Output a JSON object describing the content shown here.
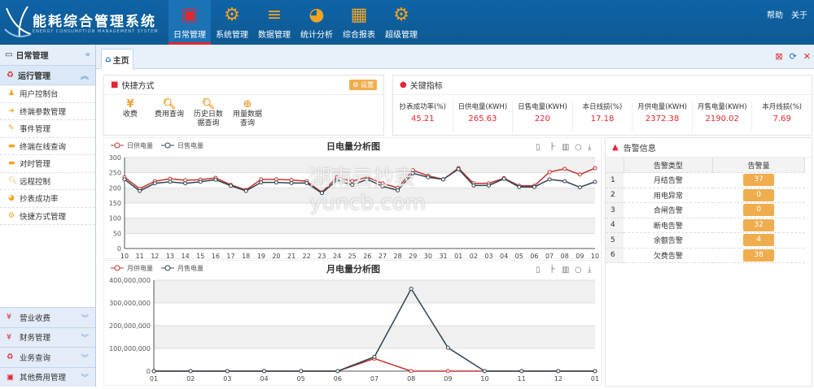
{
  "header": {
    "title": "能耗综合管理系统",
    "subtitle": "ENERGY CONSUMPTION MANAGEMENT SYSTEM",
    "links": [
      "帮助",
      "关于"
    ],
    "nav": [
      {
        "label": "日常管理",
        "icon": "calendar-icon"
      },
      {
        "label": "系统管理",
        "icon": "gears-icon"
      },
      {
        "label": "数据管理",
        "icon": "database-icon"
      },
      {
        "label": "统计分析",
        "icon": "pie-chart-icon"
      },
      {
        "label": "综合报表",
        "icon": "table-icon"
      },
      {
        "label": "超级管理",
        "icon": "gears-icon"
      }
    ]
  },
  "sidebar": {
    "title": "日常管理",
    "group": "运行管理",
    "items": [
      {
        "label": "用户控制台",
        "icon": "user-icon"
      },
      {
        "label": "终端参数管理",
        "icon": "sign-in-icon"
      },
      {
        "label": "事件管理",
        "icon": "edit-icon"
      },
      {
        "label": "终端在线查询",
        "icon": "briefcase-icon"
      },
      {
        "label": "对时管理",
        "icon": "briefcase-icon"
      },
      {
        "label": "远程控制",
        "icon": "search-icon"
      },
      {
        "label": "抄表成功率",
        "icon": "pie-icon"
      },
      {
        "label": "快捷方式管理",
        "icon": "gear-icon"
      }
    ],
    "bottom_groups": [
      {
        "label": "营业收费",
        "icon": "yen-icon"
      },
      {
        "label": "财务管理",
        "icon": "yen-icon"
      },
      {
        "label": "业务查询",
        "icon": "recycle-icon"
      },
      {
        "label": "其他费用管理",
        "icon": "calendar-icon"
      }
    ]
  },
  "tabs": {
    "home": "主页"
  },
  "shortcuts": {
    "title": "快捷方式",
    "settings": "设置",
    "items": [
      {
        "label": "收费",
        "icon": "yen-icon"
      },
      {
        "label": "费用查询",
        "icon": "search-icon"
      },
      {
        "label": "历史日数据查询",
        "icon": "search-icon"
      },
      {
        "label": "用量数据查询",
        "icon": "zoom-in-icon"
      }
    ]
  },
  "kpi": {
    "title": "关键指标",
    "items": [
      {
        "label": "抄表成功率(%)",
        "value": "45.21"
      },
      {
        "label": "日供电量(KWH)",
        "value": "265.63"
      },
      {
        "label": "日售电量(KWH)",
        "value": "220"
      },
      {
        "label": "本日线损(%)",
        "value": "17.18"
      },
      {
        "label": "月供电量(KWH)",
        "value": "2372.38"
      },
      {
        "label": "月售电量(KWH)",
        "value": "2190.02"
      },
      {
        "label": "本月线损(%)",
        "value": "7.69"
      }
    ]
  },
  "alarms": {
    "title": "告警信息",
    "columns": [
      "告警类型",
      "告警量"
    ],
    "rows": [
      {
        "n": "1",
        "type": "月结告警",
        "count": "37"
      },
      {
        "n": "2",
        "type": "用电异常",
        "count": "0"
      },
      {
        "n": "3",
        "type": "合闸告警",
        "count": "0"
      },
      {
        "n": "4",
        "type": "断电告警",
        "count": "32"
      },
      {
        "n": "5",
        "type": "余额告警",
        "count": "4"
      },
      {
        "n": "6",
        "type": "欠费告警",
        "count": "38"
      }
    ]
  },
  "watermark": "湖南云抄表 yuncb.com",
  "chart_data": [
    {
      "type": "line",
      "title": "日电量分析图",
      "ylim": [
        0,
        300
      ],
      "yticks": [
        0,
        50,
        100,
        150,
        200,
        250,
        300
      ],
      "grid": true,
      "legend": "top-left",
      "categories": [
        "10",
        "11",
        "12",
        "13",
        "14",
        "15",
        "16",
        "17",
        "18",
        "19",
        "20",
        "21",
        "22",
        "23",
        "24",
        "25",
        "26",
        "27",
        "28",
        "29",
        "30",
        "31",
        "01",
        "02",
        "03",
        "04",
        "05",
        "06",
        "07",
        "08",
        "09",
        "10"
      ],
      "series": [
        {
          "name": "日供电量",
          "color": "#c23531",
          "values": [
            235,
            197,
            222,
            230,
            225,
            227,
            233,
            210,
            193,
            228,
            228,
            226,
            222,
            185,
            235,
            222,
            235,
            215,
            200,
            258,
            240,
            228,
            265,
            215,
            215,
            232,
            207,
            207,
            252,
            263,
            244,
            265
          ]
        },
        {
          "name": "日售电量",
          "color": "#2f4554",
          "values": [
            228,
            190,
            215,
            220,
            215,
            220,
            227,
            207,
            190,
            218,
            218,
            216,
            216,
            183,
            225,
            210,
            228,
            205,
            192,
            248,
            235,
            228,
            262,
            208,
            208,
            230,
            203,
            203,
            228,
            222,
            202,
            220
          ]
        }
      ]
    },
    {
      "type": "line",
      "title": "月电量分析图",
      "ylim": [
        0,
        400000000
      ],
      "yticks": [
        0,
        100000000,
        200000000,
        300000000,
        400000000
      ],
      "grid": true,
      "legend": "top-left",
      "categories": [
        "01",
        "02",
        "03",
        "04",
        "05",
        "06",
        "07",
        "08",
        "09",
        "10",
        "11",
        "12",
        "01"
      ],
      "series": [
        {
          "name": "月供电量",
          "color": "#c23531",
          "values": [
            0,
            0,
            0,
            0,
            0,
            0,
            55000000,
            0,
            0,
            0,
            0,
            0,
            0
          ]
        },
        {
          "name": "月售电量",
          "color": "#2f4554",
          "values": [
            0,
            0,
            0,
            0,
            0,
            0,
            63000000,
            362000000,
            103000000,
            0,
            0,
            0,
            0
          ]
        }
      ]
    }
  ]
}
